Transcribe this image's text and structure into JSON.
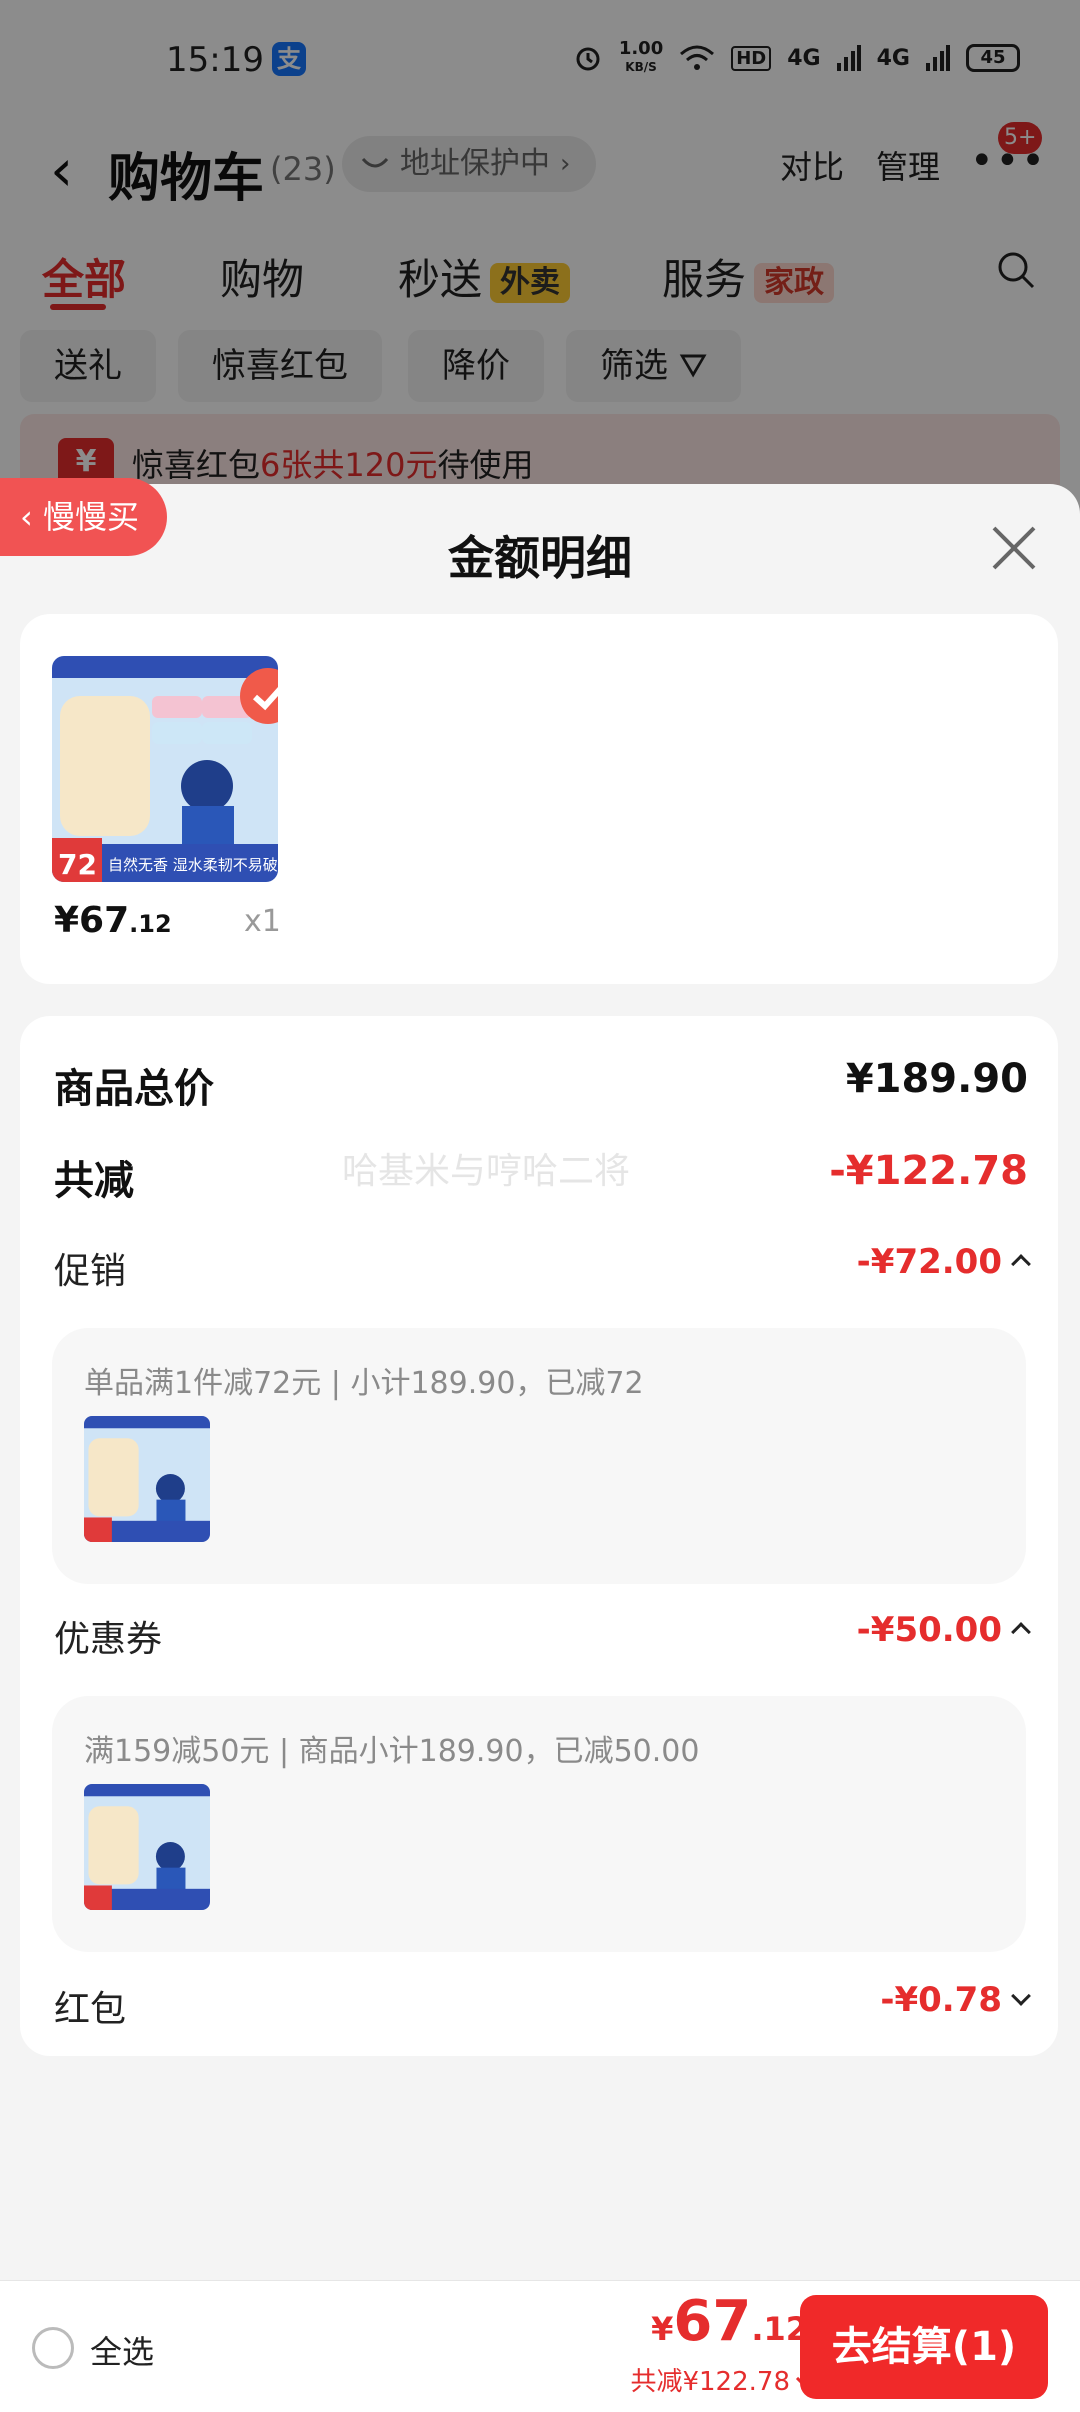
{
  "status_bar": {
    "time": "15:19",
    "app_icon": "alipay-icon",
    "speed_value": "1.00",
    "speed_unit": "KB/S",
    "hd_label": "HD",
    "net1": "4G",
    "net2": "4G",
    "battery": "45"
  },
  "cart_header": {
    "title": "购物车",
    "count": "(23)",
    "address_pill": "地址保护中",
    "compare": "对比",
    "manage": "管理",
    "more_badge": "5+"
  },
  "tabs": [
    {
      "label": "全部",
      "active": true
    },
    {
      "label": "购物",
      "tag": ""
    },
    {
      "label": "秒送",
      "tag": "外卖"
    },
    {
      "label": "服务",
      "tag": "家政"
    }
  ],
  "chips": [
    "送礼",
    "惊喜红包",
    "降价",
    "筛选"
  ],
  "coupon_banner": {
    "prefix": "惊喜红包",
    "highlight": "6张共120元",
    "suffix": "待使用"
  },
  "slow_buy": "慢慢买",
  "sheet": {
    "title": "金额明细",
    "product": {
      "price_int": "¥67",
      "price_dec": ".12",
      "qty": "x1",
      "thumb_badge": "72",
      "thumb_caption": "自然无香 湿水柔韧不易破"
    },
    "watermark": "哈基米与哼哈二将",
    "total_label": "商品总价",
    "total_value": "¥189.90",
    "reduce_label": "共减",
    "reduce_value": "-¥122.78",
    "promo": {
      "label": "促销",
      "value": "-¥72.00",
      "detail": "单品满1件减72元 | 小计189.90，已减72"
    },
    "coupon": {
      "label": "优惠券",
      "value": "-¥50.00",
      "detail": "满159减50元 | 商品小计189.90，已减50.00"
    },
    "redpacket": {
      "label": "红包",
      "value": "-¥0.78"
    }
  },
  "bottom_bar": {
    "select_all": "全选",
    "currency": "¥",
    "price_int": "67",
    "price_dec": ".12",
    "saved": "共减¥122.78",
    "checkout": "去结算(1)"
  },
  "colors": {
    "accent_red": "#e52d2d",
    "checkout_red": "#f02929"
  }
}
